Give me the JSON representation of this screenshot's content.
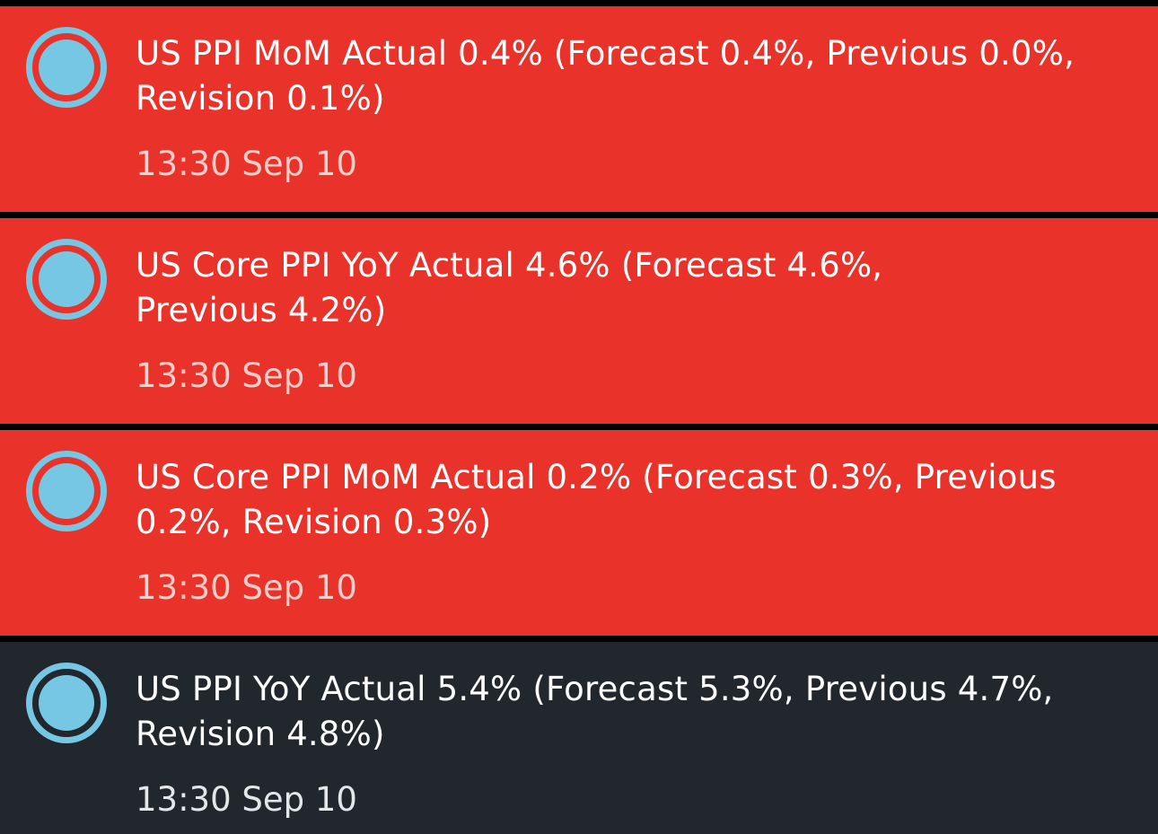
{
  "colors": {
    "alert_background": "#e8322a",
    "neutral_background": "#22272e",
    "marker": "#76c7e3",
    "separator": "#000000"
  },
  "items": [
    {
      "severity": "alert",
      "icon": "target-circle-icon",
      "headline": "US PPI MoM Actual 0.4% (Forecast 0.4%, Previous 0.0%, Revision 0.1%)",
      "time": "13:30 Sep 10"
    },
    {
      "severity": "alert",
      "icon": "target-circle-icon",
      "headline": "US Core PPI YoY Actual 4.6% (Forecast 4.6%, Previous 4.2%)",
      "time": "13:30 Sep 10"
    },
    {
      "severity": "alert",
      "icon": "target-circle-icon",
      "headline": "US Core PPI MoM Actual 0.2% (Forecast 0.3%, Previous 0.2%, Revision 0.3%)",
      "time": "13:30 Sep 10"
    },
    {
      "severity": "neutral",
      "icon": "target-circle-icon",
      "headline": "US PPI YoY Actual 5.4% (Forecast 5.3%, Previous 4.7%, Revision 4.8%)",
      "time": "13:30 Sep 10"
    }
  ]
}
